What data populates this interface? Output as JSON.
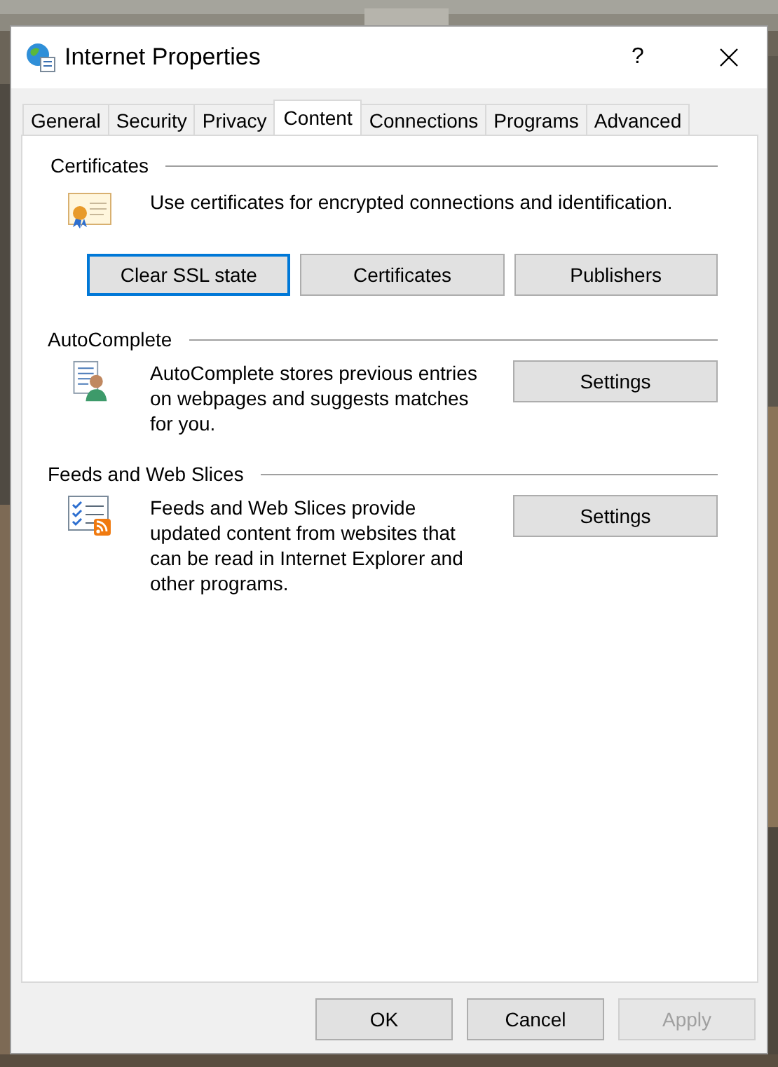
{
  "window": {
    "title": "Internet Properties",
    "help": "?"
  },
  "tabs": [
    {
      "label": "General",
      "selected": false
    },
    {
      "label": "Security",
      "selected": false
    },
    {
      "label": "Privacy",
      "selected": false
    },
    {
      "label": "Content",
      "selected": true
    },
    {
      "label": "Connections",
      "selected": false
    },
    {
      "label": "Programs",
      "selected": false
    },
    {
      "label": "Advanced",
      "selected": false
    }
  ],
  "sections": [
    {
      "kind": "certificates",
      "title": "Certificates",
      "text": "Use certificates for encrypted connections and identification.",
      "buttons": [
        {
          "label": "Clear SSL state",
          "focused": true
        },
        {
          "label": "Certificates",
          "focused": false
        },
        {
          "label": "Publishers",
          "focused": false
        }
      ]
    },
    {
      "kind": "autocomplete",
      "title": "AutoComplete",
      "text": "AutoComplete stores previous entries on webpages and suggests matches for you.",
      "buttons": [
        {
          "label": "Settings",
          "focused": false
        }
      ]
    },
    {
      "kind": "feeds",
      "title": "Feeds and Web Slices",
      "text": "Feeds and Web Slices provide updated content from websites that can be read in Internet Explorer and other programs.",
      "buttons": [
        {
          "label": "Settings",
          "focused": false
        }
      ]
    }
  ],
  "footer_buttons": [
    {
      "label": "OK",
      "disabled": false
    },
    {
      "label": "Cancel",
      "disabled": false
    },
    {
      "label": "Apply",
      "disabled": true
    }
  ]
}
